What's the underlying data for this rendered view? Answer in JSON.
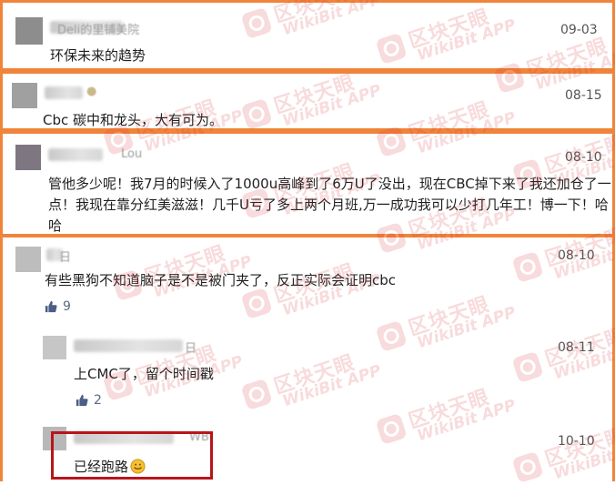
{
  "watermark": {
    "cn": "区块天眼",
    "en": "WikiBit",
    "tag": "APP",
    "color": "#d8292f"
  },
  "accent_border": "#f0843a",
  "highlight_border": "#b8151b",
  "comments": [
    {
      "name_fragment": "Deli的里铺美院",
      "date": "09-03",
      "text": "环保未来的趋势"
    },
    {
      "name_fragment": "",
      "date": "08-15",
      "text": "Cbc 碳中和龙头，大有可为。"
    },
    {
      "name_fragment": "Lou",
      "date": "08-10",
      "text": "管他多少呢！我7月的时候入了1000u高峰到了6万U了没出，现在CBC掉下来了我还加仓了一点！我现在靠分红美滋滋！几千U亏了多上两个月班,万一成功我可以少打几年工！博一下！哈哈"
    },
    {
      "name_fragment": "日",
      "date": "08-10",
      "text": "有些黑狗不知道脑子是不是被门夹了，反正实际会证明cbc",
      "likes": "9",
      "replies": [
        {
          "name_fragment": "日",
          "date": "08-11",
          "text": "上CMC了，留个时间戳",
          "likes": "2"
        },
        {
          "name_fragment": "WB",
          "date": "10-10",
          "text": "已经跑路",
          "emoji": "smile-emoji"
        }
      ]
    }
  ]
}
